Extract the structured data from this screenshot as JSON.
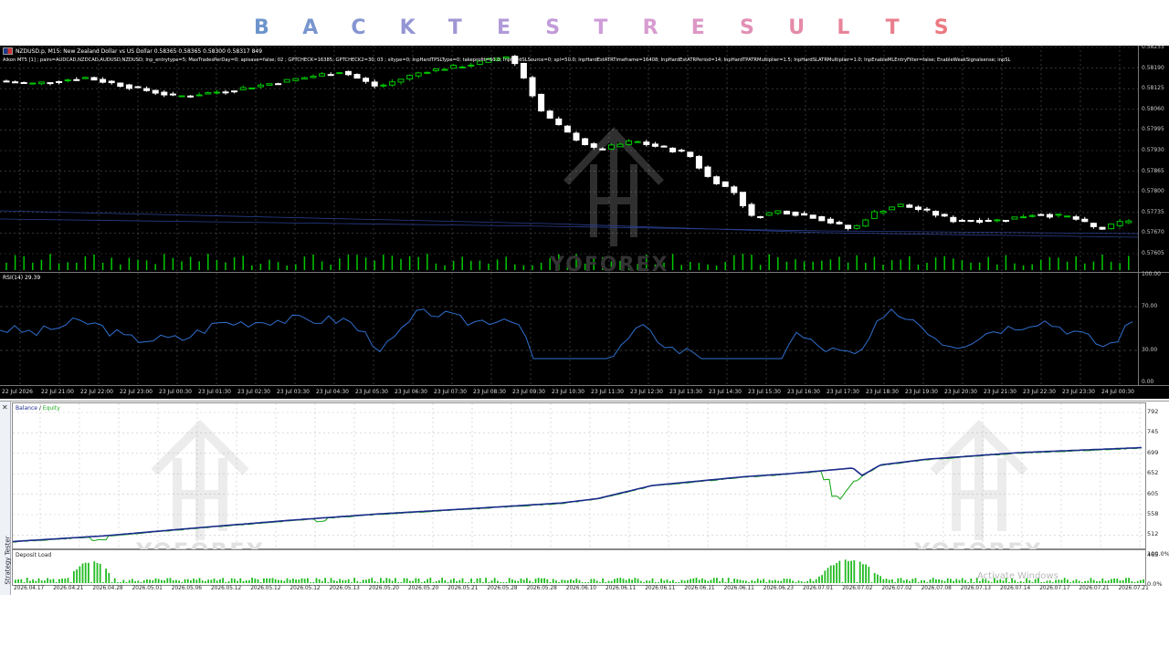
{
  "banner": {
    "letters": [
      {
        "ch": "B",
        "color": "#6e94cc"
      },
      {
        "ch": "A",
        "color": "#7895cf"
      },
      {
        "ch": "C",
        "color": "#8595d2"
      },
      {
        "ch": "K",
        "color": "#9495d4"
      },
      {
        "ch": "T",
        "color": "#a096d4"
      },
      {
        "ch": "E",
        "color": "#b09ad8"
      },
      {
        "ch": "S",
        "color": "#c29ad8"
      },
      {
        "ch": "T",
        "color": "#cf9cd8"
      },
      {
        "ch": "R",
        "color": "#d79bd0"
      },
      {
        "ch": "E",
        "color": "#dd97c4"
      },
      {
        "ch": "S",
        "color": "#e28fb5"
      },
      {
        "ch": "U",
        "color": "#e58aa7"
      },
      {
        "ch": "L",
        "color": "#e7849a"
      },
      {
        "ch": "T",
        "color": "#e97f8d"
      },
      {
        "ch": "S",
        "color": "#eb7a80"
      }
    ]
  },
  "chart": {
    "symbol": "NZDUSD.p, M15:  New Zealand Dollar vs US Dollar  0.58365 0.58365 0.58300 0.58317  849",
    "params": "Aikon MT5 [1] ; pairs=AUDCAD,NZDCAD,AUDUSD,NZDUSD; Inp_entrytype=5; MaxTradesPerDay=0; apisave=false; 02 ; GPTCHECK=16385; GPTCHECK2=30; 03 ; sltype=0; InpHardTPSLType=0; takeprofit=60.0; InpHardSLSource=0; spl=50.0; InpHardEstATRTimeframe=16408; InpHardEstATRPeriod=14; InpHardTPATRMultiplier=1.5; InpHardSLATRMultiplier=1.0; InpEnableMLEntryFilter=false; EnableWeakSignalsense; inpSL",
    "rsi_label": "RSI(14) 29.39",
    "price_ticks": [
      "0.58255",
      "0.58190",
      "0.58125",
      "0.58060",
      "0.57995",
      "0.57930",
      "0.57865",
      "0.57800",
      "0.57735",
      "0.57670",
      "0.57605"
    ],
    "rsi_ticks": [
      "100.00",
      "70.00",
      "30.00",
      "0.00"
    ],
    "time_ticks": [
      "22 Jul 2026",
      "22 Jul 21:00",
      "22 Jul 22:00",
      "22 Jul 23:00",
      "23 Jul 00:30",
      "23 Jul 01:30",
      "23 Jul 02:30",
      "23 Jul 03:30",
      "23 Jul 04:30",
      "23 Jul 05:30",
      "23 Jul 06:30",
      "23 Jul 07:30",
      "23 Jul 08:30",
      "23 Jul 09:30",
      "23 Jul 10:30",
      "23 Jul 11:30",
      "23 Jul 12:30",
      "23 Jul 13:30",
      "23 Jul 14:30",
      "23 Jul 15:30",
      "23 Jul 16:30",
      "23 Jul 17:30",
      "23 Jul 18:30",
      "23 Jul 19:30",
      "23 Jul 20:30",
      "23 Jul 21:30",
      "23 Jul 22:30",
      "23 Jul 23:30",
      "24 Jul 00:30"
    ],
    "watermark": "YOFOREX",
    "colors": {
      "bull": "#00c800",
      "bear": "#ffffff",
      "rsi": "#2f6fcf",
      "grid": "#555555",
      "volume": "#00c800"
    }
  },
  "tester": {
    "side_label": "Strategy Tester",
    "balance_label": "Balance",
    "equity_label": "Equity",
    "balance_ticks": [
      "792",
      "745",
      "699",
      "652",
      "605",
      "558",
      "512",
      "465"
    ],
    "deposit_label": "Deposit Load",
    "deposit_ticks": [
      "100.0%",
      "0.0%"
    ],
    "date_ticks": [
      "2026.04.17",
      "2026.04.21",
      "2026.04.28",
      "2026.05.01",
      "2026.05.06",
      "2026.05.12",
      "2026.05.12",
      "2026.05.12",
      "2026.05.13",
      "2026.05.20",
      "2026.05.20",
      "2026.05.21",
      "2026.05.28",
      "2026.05.28",
      "2026.06.10",
      "2026.06.11",
      "2026.06.11",
      "2026.06.11",
      "2026.06.11",
      "2026.06.23",
      "2026.07.01",
      "2026.07.02",
      "2026.07.02",
      "2026.07.08",
      "2026.07.13",
      "2026.07.14",
      "2026.07.17",
      "2026.07.21",
      "2026.07.21"
    ],
    "watermark": "YOFOREX",
    "activate_text": "Activate Windows",
    "colors": {
      "balance": "#1b2a8c",
      "equity": "#22aa22",
      "deposit": "#22bb22",
      "grid": "#c8c8c8"
    }
  }
}
